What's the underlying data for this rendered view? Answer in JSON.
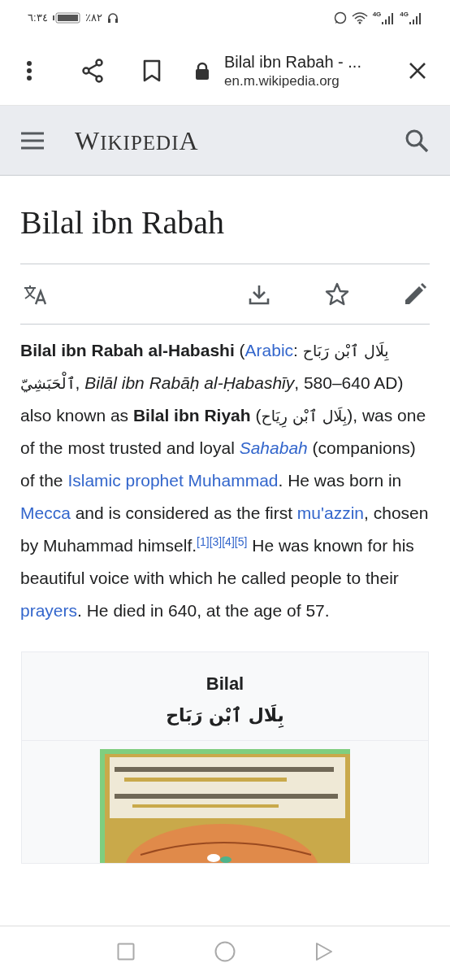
{
  "status_bar": {
    "time": "٦:٣٤",
    "battery": "٪٨٢",
    "network_labels": [
      "4G",
      "4G"
    ]
  },
  "browser_bar": {
    "title": "Bilal ibn Rabah - ...",
    "url": "en.m.wikipedia.org"
  },
  "site_header": {
    "logo": "WIKIPEDIA"
  },
  "article": {
    "title": "Bilal ibn Rabah",
    "paragraph": [
      {
        "kind": "bold",
        "text": "Bilal ibn Rabah al-Habashi"
      },
      {
        "kind": "text",
        "text": " ("
      },
      {
        "kind": "link",
        "text": "Arabic"
      },
      {
        "kind": "text",
        "text": ": "
      },
      {
        "kind": "arabic",
        "text": "بِلَال ٱبْن رَبَاح ٱلْحَبَشِيّ"
      },
      {
        "kind": "text",
        "text": ", "
      },
      {
        "kind": "italic",
        "text": "Bilāl ibn Rabāḥ al-Ḥabashīy"
      },
      {
        "kind": "text",
        "text": ", 580–640 AD) also known as "
      },
      {
        "kind": "bold",
        "text": "Bilal ibn Riyah"
      },
      {
        "kind": "text",
        "text": " ("
      },
      {
        "kind": "arabic",
        "text": "بِلَال ٱبْن رِيَاح"
      },
      {
        "kind": "text",
        "text": "), was one of the most trusted and loyal "
      },
      {
        "kind": "italic_link",
        "text": "Sahabah"
      },
      {
        "kind": "text",
        "text": " (companions) of the "
      },
      {
        "kind": "link",
        "text": "Islamic prophet Muhammad"
      },
      {
        "kind": "text",
        "text": ". He was born in "
      },
      {
        "kind": "link",
        "text": "Mecca"
      },
      {
        "kind": "text",
        "text": " and is considered as the first "
      },
      {
        "kind": "link",
        "text": "mu'azzin"
      },
      {
        "kind": "text",
        "text": ", chosen by Muhammad himself."
      },
      {
        "kind": "ref",
        "text": "[1]"
      },
      {
        "kind": "ref",
        "text": "[3]"
      },
      {
        "kind": "ref",
        "text": "[4]"
      },
      {
        "kind": "ref",
        "text": "[5]"
      },
      {
        "kind": "text",
        "text": " He was known for his beautiful voice with which he called people to their "
      },
      {
        "kind": "link",
        "text": "prayers"
      },
      {
        "kind": "text",
        "text": ". He died in 640, at the age of 57."
      }
    ],
    "infobox": {
      "title": "Bilal",
      "subtitle": "بِلَال ٱبْن رَبَاح"
    }
  }
}
